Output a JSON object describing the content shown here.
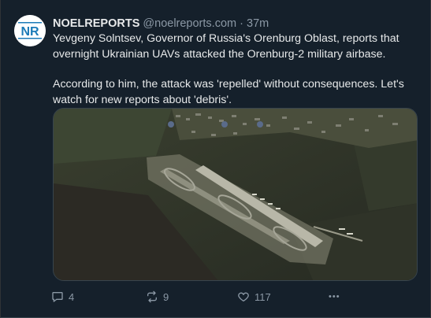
{
  "post": {
    "author": "NOELREPORTS",
    "handle": "@noelreports.com",
    "separator": "·",
    "time": "37m",
    "avatar_text": "NR",
    "text_paragraphs": [
      "Yevgeny Solntsev, Governor of Russia's Orenburg Oblast, reports that overnight Ukrainian UAVs attacked the Orenburg-2 military airbase.",
      "According to him, the attack was 'repelled' without consequences. Let's watch for new reports about 'debris'."
    ],
    "media": {
      "alt_icon_names": [
        "location-pin-icon",
        "location-pin-icon",
        "location-pin-icon"
      ]
    }
  },
  "actions": {
    "reply_count": "4",
    "repost_count": "9",
    "like_count": "117",
    "more_label": "•••"
  },
  "colors": {
    "background": "#15202b",
    "primary_text": "#e7e9ea",
    "secondary_text": "#8b98a5",
    "brand_blue": "#1d7bb8"
  },
  "icons": {
    "reply": "chat-bubble-icon",
    "repost": "repost-arrows-icon",
    "like": "heart-icon",
    "more": "more-dots-icon"
  }
}
